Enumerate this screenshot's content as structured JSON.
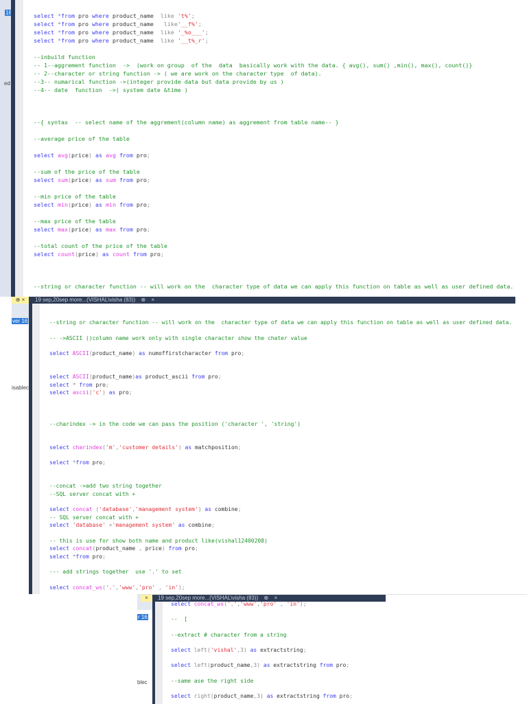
{
  "colors": {
    "keyword": "#3b3bf0",
    "function": "#e23be0",
    "string": "#e0303a",
    "comment": "#22942c",
    "tab_bar": "#2d3b55",
    "pinned_tab": "#fff29e",
    "selection": "#2f7bd8"
  },
  "panels": [
    {
      "side_labels": {
        "selected": "16",
        "partial": "ed"
      },
      "lines": [
        [
          [
            "k",
            "select "
          ],
          [
            "o",
            "*"
          ],
          [
            "k",
            "from "
          ],
          [
            "p",
            "pro "
          ],
          [
            "k",
            "where "
          ],
          [
            "p",
            "product_name  "
          ],
          [
            "o",
            "like "
          ],
          [
            "s",
            "'t%'"
          ],
          [
            "o",
            ";"
          ]
        ],
        [
          [
            "k",
            "select "
          ],
          [
            "o",
            "*"
          ],
          [
            "k",
            "from "
          ],
          [
            "p",
            "pro "
          ],
          [
            "k",
            "where "
          ],
          [
            "p",
            "product_name   "
          ],
          [
            "o",
            "like"
          ],
          [
            "s",
            "'__f%'"
          ],
          [
            "o",
            ";"
          ]
        ],
        [
          [
            "k",
            "select "
          ],
          [
            "o",
            "*"
          ],
          [
            "k",
            "from "
          ],
          [
            "p",
            "pro "
          ],
          [
            "k",
            "where "
          ],
          [
            "p",
            "product_name  "
          ],
          [
            "o",
            "like "
          ],
          [
            "s",
            "'_%o___'"
          ],
          [
            "o",
            ";"
          ]
        ],
        [
          [
            "k",
            "select "
          ],
          [
            "o",
            "*"
          ],
          [
            "k",
            "from "
          ],
          [
            "p",
            "pro "
          ],
          [
            "k",
            "where "
          ],
          [
            "p",
            "product_name  "
          ],
          [
            "o",
            "like "
          ],
          [
            "s",
            "'__t%_r'"
          ],
          [
            "o",
            ";"
          ]
        ],
        [],
        [
          [
            "c",
            "--inbuild function"
          ]
        ],
        [
          [
            "c",
            "-- 1--aggrement function  ->  (work on group  of the  data  basically work with the data. { avg(), sum() ,min(), max(), count()}"
          ]
        ],
        [
          [
            "c",
            "-- 2--character or string function -> ( we are work on the character type  of data)."
          ]
        ],
        [
          [
            "c",
            "--3-- numarical function ->(integer provide data but data provide by us )"
          ]
        ],
        [
          [
            "c",
            "--4-- date  function  ->( system date &time )"
          ]
        ],
        [],
        [],
        [],
        [
          [
            "c",
            "--{ syntax  -- select name of the aggrement(column name) as aggrement from table name-- }"
          ]
        ],
        [],
        [
          [
            "c",
            "--average price of the table"
          ]
        ],
        [],
        [
          [
            "k",
            "select "
          ],
          [
            "f",
            "avg"
          ],
          [
            "o",
            "("
          ],
          [
            "p",
            "price"
          ],
          [
            "o",
            ") "
          ],
          [
            "k",
            "as "
          ],
          [
            "f",
            "avg "
          ],
          [
            "k",
            "from "
          ],
          [
            "p",
            "pro"
          ],
          [
            "o",
            ";"
          ]
        ],
        [],
        [
          [
            "c",
            "--sum of the price of the table"
          ]
        ],
        [
          [
            "k",
            "select "
          ],
          [
            "f",
            "sum"
          ],
          [
            "o",
            "("
          ],
          [
            "p",
            "price"
          ],
          [
            "o",
            ") "
          ],
          [
            "k",
            "as "
          ],
          [
            "f",
            "sum "
          ],
          [
            "k",
            "from "
          ],
          [
            "p",
            "pro"
          ],
          [
            "o",
            ";"
          ]
        ],
        [],
        [
          [
            "c",
            "--min price of the table"
          ]
        ],
        [
          [
            "k",
            "select "
          ],
          [
            "f",
            "min"
          ],
          [
            "o",
            "("
          ],
          [
            "p",
            "price"
          ],
          [
            "o",
            ") "
          ],
          [
            "k",
            "as "
          ],
          [
            "f",
            "min "
          ],
          [
            "k",
            "from "
          ],
          [
            "p",
            "pro"
          ],
          [
            "o",
            ";"
          ]
        ],
        [],
        [
          [
            "c",
            "--max price of the table"
          ]
        ],
        [
          [
            "k",
            "select "
          ],
          [
            "f",
            "max"
          ],
          [
            "o",
            "("
          ],
          [
            "p",
            "price"
          ],
          [
            "o",
            ") "
          ],
          [
            "k",
            "as "
          ],
          [
            "f",
            "max "
          ],
          [
            "k",
            "from "
          ],
          [
            "p",
            "pro"
          ],
          [
            "o",
            ";"
          ]
        ],
        [],
        [
          [
            "c",
            "--total count of the price of the table"
          ]
        ],
        [
          [
            "k",
            "select "
          ],
          [
            "f",
            "count"
          ],
          [
            "o",
            "("
          ],
          [
            "p",
            "price"
          ],
          [
            "o",
            ") "
          ],
          [
            "k",
            "as "
          ],
          [
            "f",
            "count "
          ],
          [
            "k",
            "from "
          ],
          [
            "p",
            "pro"
          ],
          [
            "o",
            ";"
          ]
        ],
        [],
        [],
        [],
        [
          [
            "c",
            "--string or character function -- will work on the  character type of data we can apply this function on table as well as user defined data."
          ]
        ]
      ]
    },
    {
      "tab": {
        "title": "19 sep,20sep more...(VISHAL\\visha (83))",
        "pin": "⊕",
        "close": "×"
      },
      "pinned_tab": {
        "pin": "⊕",
        "close": "×"
      },
      "side_labels": {
        "selected": "ver 16",
        "partial": "isablec"
      },
      "lines": [
        [
          [
            "c",
            "--string or character function -- will work on the  character type of data we can apply this function on table as well as user defined data."
          ]
        ],
        [],
        [
          [
            "c",
            "-- ->ASCII ()column name work only with single character show the chater value"
          ]
        ],
        [],
        [
          [
            "k",
            "select "
          ],
          [
            "f",
            "ASCII"
          ],
          [
            "o",
            "("
          ],
          [
            "p",
            "product_name"
          ],
          [
            "o",
            ") "
          ],
          [
            "k",
            "as "
          ],
          [
            "p",
            "numoffirstcharacter "
          ],
          [
            "k",
            "from "
          ],
          [
            "p",
            "pro"
          ],
          [
            "o",
            ";"
          ]
        ],
        [],
        [],
        [
          [
            "k",
            "select "
          ],
          [
            "f",
            "ASCII"
          ],
          [
            "o",
            "("
          ],
          [
            "p",
            "product_name"
          ],
          [
            "o",
            ")"
          ],
          [
            "k",
            "as "
          ],
          [
            "p",
            "product_ascii "
          ],
          [
            "k",
            "from "
          ],
          [
            "p",
            "pro"
          ],
          [
            "o",
            ";"
          ]
        ],
        [
          [
            "k",
            "select "
          ],
          [
            "o",
            "* "
          ],
          [
            "k",
            "from "
          ],
          [
            "p",
            "pro"
          ],
          [
            "o",
            ";"
          ]
        ],
        [
          [
            "k",
            "select "
          ],
          [
            "f",
            "ascii"
          ],
          [
            "o",
            "("
          ],
          [
            "s",
            "'c'"
          ],
          [
            "o",
            ") "
          ],
          [
            "k",
            "as "
          ],
          [
            "p",
            "pro"
          ],
          [
            "o",
            ";"
          ]
        ],
        [],
        [],
        [],
        [
          [
            "c",
            "--charindex -> in the code we can pass the position ('character ', 'string')"
          ]
        ],
        [],
        [],
        [
          [
            "k",
            "select "
          ],
          [
            "f",
            "charindex"
          ],
          [
            "o",
            "("
          ],
          [
            "s",
            "'m'"
          ],
          [
            "o",
            ","
          ],
          [
            "s",
            "'customer details'"
          ],
          [
            "o",
            ") "
          ],
          [
            "k",
            "as "
          ],
          [
            "p",
            "matchposition"
          ],
          [
            "o",
            ";"
          ]
        ],
        [],
        [
          [
            "k",
            "select "
          ],
          [
            "o",
            "*"
          ],
          [
            "k",
            "from "
          ],
          [
            "p",
            "pro"
          ],
          [
            "o",
            ";"
          ]
        ],
        [],
        [],
        [
          [
            "c",
            "--concat ->add two string together"
          ]
        ],
        [
          [
            "c",
            "--SQL server concat with +"
          ]
        ],
        [],
        [
          [
            "k",
            "select "
          ],
          [
            "f",
            "concat "
          ],
          [
            "o",
            "("
          ],
          [
            "s",
            "'database'"
          ],
          [
            "o",
            ","
          ],
          [
            "s",
            "'management system'"
          ],
          [
            "o",
            ") "
          ],
          [
            "k",
            "as "
          ],
          [
            "p",
            "combine"
          ],
          [
            "o",
            ";"
          ]
        ],
        [
          [
            "c",
            "-- SQL server concat with +"
          ]
        ],
        [
          [
            "k",
            "select "
          ],
          [
            "s",
            "'database' "
          ],
          [
            "o",
            "+"
          ],
          [
            "s",
            "'management system' "
          ],
          [
            "k",
            "as "
          ],
          [
            "p",
            "combine"
          ],
          [
            "o",
            ";"
          ]
        ],
        [],
        [
          [
            "c",
            "-- this is use for show both name and product like(vishal12400208)"
          ]
        ],
        [
          [
            "k",
            "select "
          ],
          [
            "f",
            "concat"
          ],
          [
            "o",
            "("
          ],
          [
            "p",
            "product_name "
          ],
          [
            "o",
            ", "
          ],
          [
            "p",
            "price"
          ],
          [
            "o",
            ") "
          ],
          [
            "k",
            "from "
          ],
          [
            "p",
            "pro"
          ],
          [
            "o",
            ";"
          ]
        ],
        [
          [
            "k",
            "select "
          ],
          [
            "o",
            "*"
          ],
          [
            "k",
            "from "
          ],
          [
            "p",
            "pro"
          ],
          [
            "o",
            ";"
          ]
        ],
        [],
        [
          [
            "c",
            "--- add strings together  use '.' to set"
          ]
        ],
        [],
        [
          [
            "k",
            "select "
          ],
          [
            "f",
            "concat_ws"
          ],
          [
            "o",
            "("
          ],
          [
            "s",
            "'.'"
          ],
          [
            "o",
            ","
          ],
          [
            "s",
            "'www'"
          ],
          [
            "o",
            ","
          ],
          [
            "s",
            "'pro' "
          ],
          [
            "o",
            ", "
          ],
          [
            "s",
            "'in'"
          ],
          [
            "o",
            ");"
          ]
        ]
      ]
    },
    {
      "tab": {
        "title": "19 sep,20sep more...(VISHAL\\visha (83))",
        "pin": "⊕",
        "close": "×"
      },
      "pinned_tab": {
        "close": "×"
      },
      "side_labels": {
        "selected": "r 16",
        "partial": "blec"
      },
      "lines": [
        [
          [
            "k",
            "select "
          ],
          [
            "f",
            "concat_ws"
          ],
          [
            "o",
            "("
          ],
          [
            "s",
            "'.'"
          ],
          [
            "o",
            ","
          ],
          [
            "s",
            "'www'"
          ],
          [
            "o",
            ","
          ],
          [
            "s",
            "'pro' "
          ],
          [
            "o",
            ", "
          ],
          [
            "s",
            "'in'"
          ],
          [
            "o",
            ");"
          ]
        ],
        [],
        [
          [
            "c",
            "--  ["
          ]
        ],
        [],
        [
          [
            "c",
            "--extract # character from a string"
          ]
        ],
        [],
        [
          [
            "k",
            "select "
          ],
          [
            "o",
            "left("
          ],
          [
            "s",
            "'vishal'"
          ],
          [
            "o",
            ",3) "
          ],
          [
            "k",
            "as "
          ],
          [
            "p",
            "extractstring"
          ],
          [
            "o",
            ";"
          ]
        ],
        [],
        [
          [
            "k",
            "select "
          ],
          [
            "o",
            "left("
          ],
          [
            "p",
            "product_name"
          ],
          [
            "o",
            ",3) "
          ],
          [
            "k",
            "as "
          ],
          [
            "p",
            "extractstring "
          ],
          [
            "k",
            "from "
          ],
          [
            "p",
            "pro"
          ],
          [
            "o",
            ";"
          ]
        ],
        [],
        [
          [
            "c",
            "--same ase the right side"
          ]
        ],
        [],
        [
          [
            "k",
            "select "
          ],
          [
            "o",
            "right("
          ],
          [
            "p",
            "product_name"
          ],
          [
            "o",
            ",3) "
          ],
          [
            "k",
            "as "
          ],
          [
            "p",
            "extractstring "
          ],
          [
            "k",
            "from "
          ],
          [
            "p",
            "pro"
          ],
          [
            "o",
            ";"
          ]
        ]
      ]
    }
  ]
}
